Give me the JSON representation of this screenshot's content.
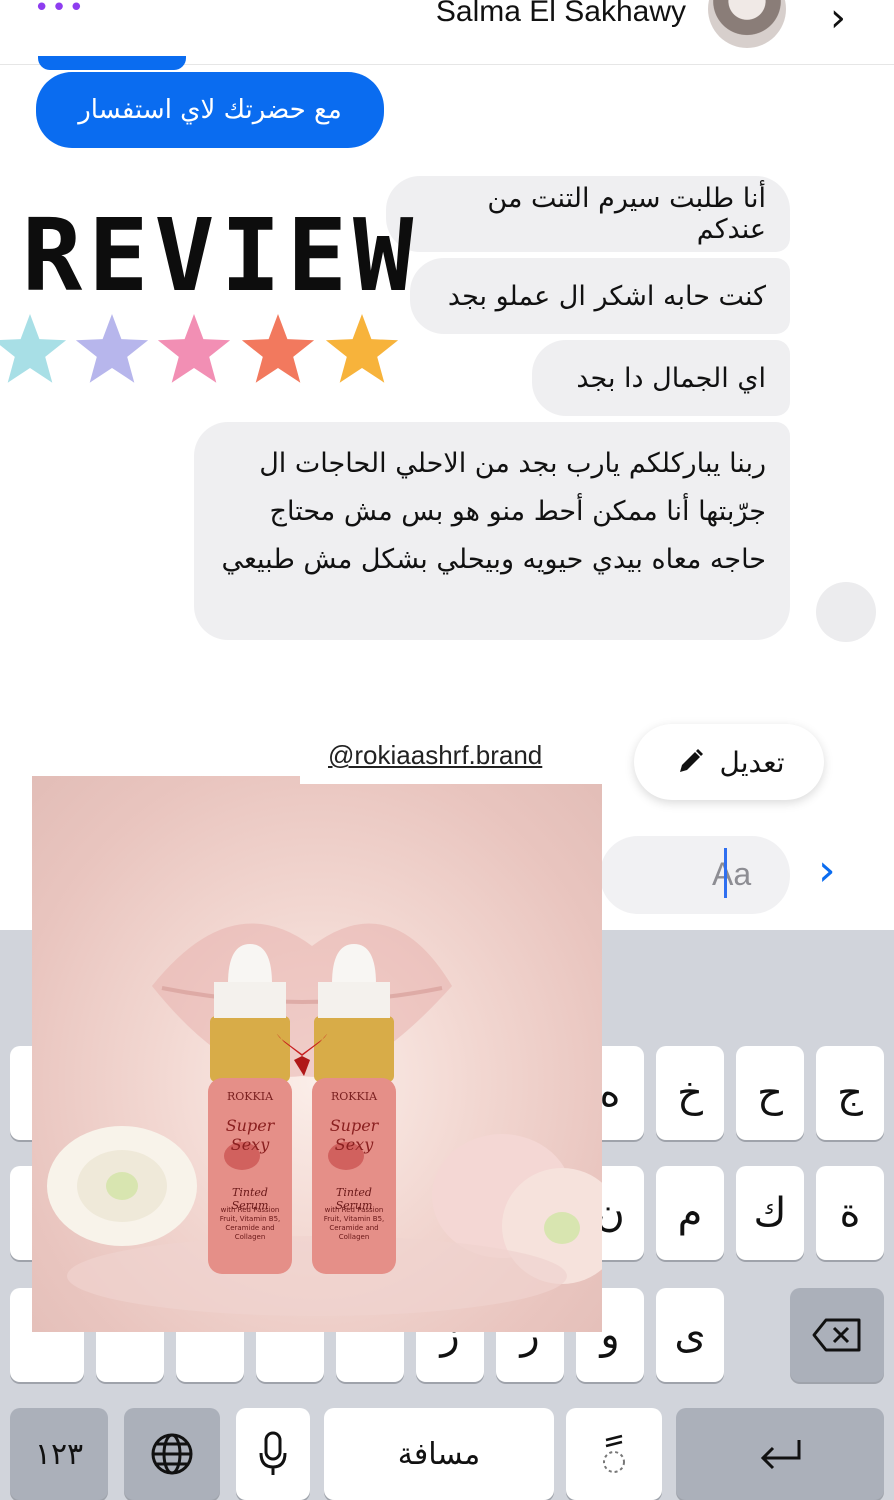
{
  "header": {
    "contact_name": "Salma El Sakhawy",
    "menu_icon": "more-dots-icon",
    "next_icon": "chevron-right-icon"
  },
  "chat": {
    "sent_message": "مع حضرتك لاي استفسار",
    "received_messages": [
      "أنا طلبت سيرم التنت من عندكم",
      "كنت حابه اشكر ال عملو بجد",
      "اي الجمال دا بجد",
      "ربنا يباركلكم يارب بجد من الاحلي الحاجات ال جرّبتها أنا ممكن أحط منو هو بس مش محتاج حاجه معاه بيدي حيويه وبيحلي بشكل مش طبيعي"
    ]
  },
  "sticker": {
    "review_text": "REVIEW",
    "star_colors": [
      "#a8dfe6",
      "#b7b6ec",
      "#f28fb4",
      "#f2795e",
      "#f7b33b"
    ]
  },
  "edit_button": {
    "label": "تعديل",
    "icon": "pencil-icon"
  },
  "brand_handle": "@rokiaashrf.brand",
  "composer": {
    "placeholder": "Aa",
    "send_icon": "chevron-right-icon"
  },
  "product": {
    "brand": "ROKKIA",
    "product_name": "Super Sexy",
    "product_type": "Tinted Serum",
    "ingredients": "with Red Passion Fruit, Vitamin B5, Ceramide and Collagen"
  },
  "keyboard": {
    "row1": [
      "ج",
      "ح",
      "خ",
      "ه"
    ],
    "row2": [
      "ة",
      "ك",
      "م",
      "ن"
    ],
    "row3": [
      "ى",
      "و",
      "ر",
      "ز"
    ],
    "space_label": "مسافة",
    "numbers_label": "١٢٣",
    "colors": {
      "background": "#d1d4db",
      "key": "#ffffff",
      "key_dark": "#abb0ba"
    }
  },
  "colors": {
    "accent": "#0a6cf0",
    "bubble_received": "#efeff1"
  }
}
